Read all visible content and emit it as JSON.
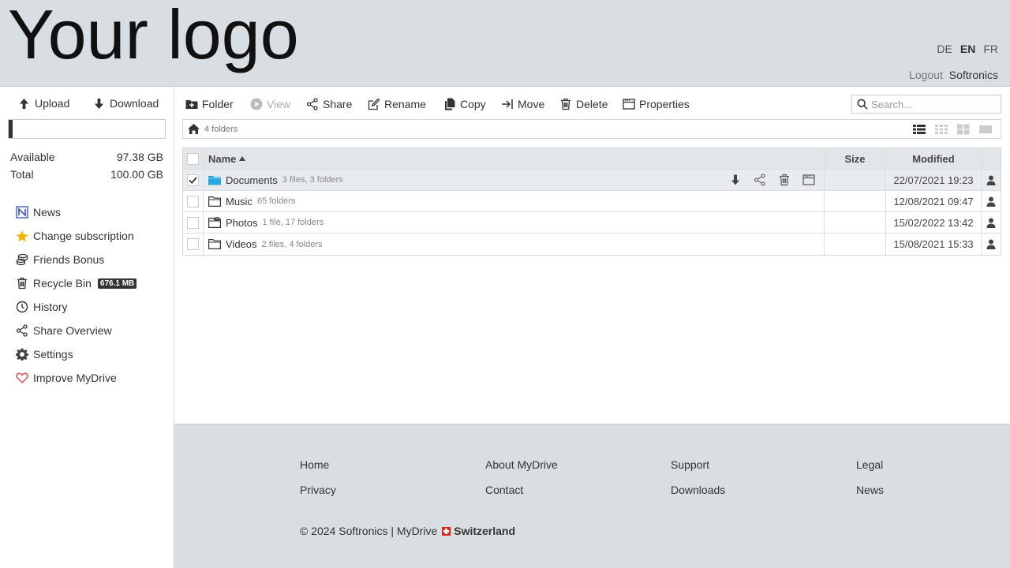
{
  "header": {
    "logo_text": "Your logo",
    "languages": [
      "DE",
      "EN",
      "FR"
    ],
    "active_language": "EN",
    "logout_label": "Logout",
    "username": "Softronics"
  },
  "sidebar": {
    "upload_label": "Upload",
    "download_label": "Download",
    "quota_used_fraction": 0.0262,
    "available_label": "Available",
    "available_value": "97.38 GB",
    "total_label": "Total",
    "total_value": "100.00 GB",
    "items": [
      {
        "label": "News",
        "icon": "news-icon"
      },
      {
        "label": "Change subscription",
        "icon": "star-icon"
      },
      {
        "label": "Friends Bonus",
        "icon": "coins-icon"
      },
      {
        "label": "Recycle Bin",
        "icon": "trash-icon",
        "badge": "676.1 MB"
      },
      {
        "label": "History",
        "icon": "clock-icon"
      },
      {
        "label": "Share Overview",
        "icon": "share-icon"
      },
      {
        "label": "Settings",
        "icon": "gear-icon"
      },
      {
        "label": "Improve MyDrive",
        "icon": "heart-icon"
      }
    ]
  },
  "toolbar": {
    "folder_label": "Folder",
    "view_label": "View",
    "share_label": "Share",
    "rename_label": "Rename",
    "copy_label": "Copy",
    "move_label": "Move",
    "delete_label": "Delete",
    "properties_label": "Properties",
    "search_placeholder": "Search..."
  },
  "breadcrumb": {
    "count_label": "4 folders"
  },
  "table": {
    "columns": {
      "name": "Name",
      "size": "Size",
      "modified": "Modified"
    },
    "rows": [
      {
        "name": "Documents",
        "meta": "3 files, 3 folders",
        "size": "",
        "modified": "22/07/2021 19:23",
        "selected": true
      },
      {
        "name": "Music",
        "meta": "65 folders",
        "size": "",
        "modified": "12/08/2021 09:47",
        "selected": false
      },
      {
        "name": "Photos",
        "meta": "1 file, 17 folders",
        "size": "",
        "modified": "15/02/2022 13:42",
        "selected": false
      },
      {
        "name": "Videos",
        "meta": "2 files, 4 folders",
        "size": "",
        "modified": "15/08/2021 15:33",
        "selected": false
      }
    ]
  },
  "footer": {
    "links": [
      "Home",
      "About MyDrive",
      "Support",
      "Legal",
      "Privacy",
      "Contact",
      "Downloads",
      "News"
    ],
    "copyright": "© 2024 Softronics | MyDrive",
    "country": "Switzerland"
  },
  "colors": {
    "header_bg": "#d9dee3",
    "folder_selected": "#29a8e0",
    "heart": "#d9534f",
    "star": "#f0b400",
    "news": "#3a4fb8",
    "swiss_red": "#d52b1e"
  }
}
